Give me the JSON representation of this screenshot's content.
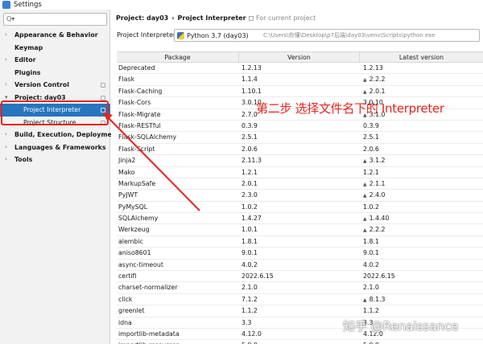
{
  "window": {
    "title": "Settings"
  },
  "search": {
    "placeholder": ""
  },
  "sidebar": {
    "items": [
      {
        "label": "Appearance & Behavior",
        "kind": "group",
        "expanded": false
      },
      {
        "label": "Keymap",
        "kind": "plain"
      },
      {
        "label": "Editor",
        "kind": "group",
        "expanded": false
      },
      {
        "label": "Plugins",
        "kind": "plain"
      },
      {
        "label": "Version Control",
        "kind": "group",
        "expanded": false
      },
      {
        "label": "Project: day03",
        "kind": "group",
        "expanded": true
      },
      {
        "label": "Project Interpreter",
        "kind": "sub",
        "selected": true
      },
      {
        "label": "Project Structure",
        "kind": "sub"
      },
      {
        "label": "Build, Execution, Deployment",
        "kind": "group",
        "expanded": false
      },
      {
        "label": "Languages & Frameworks",
        "kind": "group",
        "expanded": false
      },
      {
        "label": "Tools",
        "kind": "group",
        "expanded": false
      }
    ]
  },
  "header": {
    "crumb_project": "Project: day03",
    "crumb_sep": "›",
    "crumb_page": "Project Interpreter",
    "scope_note": "For current project"
  },
  "interpreter": {
    "label": "Project Interpreter:",
    "name": "Python 3.7 (day03)",
    "path": "C:\\Users\\你懂\\Desktop\\p7后端\\day03\\venv\\Scripts\\python.exe"
  },
  "table": {
    "columns": [
      "Package",
      "Version",
      "Latest version"
    ],
    "rows": [
      {
        "pkg": "Deprecated",
        "ver": "1.2.13",
        "latest": "1.2.13",
        "upgrade": false
      },
      {
        "pkg": "Flask",
        "ver": "1.1.4",
        "latest": "2.2.2",
        "upgrade": true
      },
      {
        "pkg": "Flask-Caching",
        "ver": "1.10.1",
        "latest": "2.0.1",
        "upgrade": true
      },
      {
        "pkg": "Flask-Cors",
        "ver": "3.0.10",
        "latest": "3.0.10",
        "upgrade": false
      },
      {
        "pkg": "Flask-Migrate",
        "ver": "2.7.0",
        "latest": "3.1.0",
        "upgrade": true
      },
      {
        "pkg": "Flask-RESTful",
        "ver": "0.3.9",
        "latest": "0.3.9",
        "upgrade": false
      },
      {
        "pkg": "Flask-SQLAlchemy",
        "ver": "2.5.1",
        "latest": "2.5.1",
        "upgrade": false
      },
      {
        "pkg": "Flask-Script",
        "ver": "2.0.6",
        "latest": "2.0.6",
        "upgrade": false
      },
      {
        "pkg": "Jinja2",
        "ver": "2.11.3",
        "latest": "3.1.2",
        "upgrade": true
      },
      {
        "pkg": "Mako",
        "ver": "1.2.1",
        "latest": "1.2.1",
        "upgrade": false
      },
      {
        "pkg": "MarkupSafe",
        "ver": "2.0.1",
        "latest": "2.1.1",
        "upgrade": true
      },
      {
        "pkg": "PyJWT",
        "ver": "2.3.0",
        "latest": "2.4.0",
        "upgrade": true
      },
      {
        "pkg": "PyMySQL",
        "ver": "1.0.2",
        "latest": "1.0.2",
        "upgrade": false
      },
      {
        "pkg": "SQLAlchemy",
        "ver": "1.4.27",
        "latest": "1.4.40",
        "upgrade": true
      },
      {
        "pkg": "Werkzeug",
        "ver": "1.0.1",
        "latest": "2.2.2",
        "upgrade": true
      },
      {
        "pkg": "alembic",
        "ver": "1.8.1",
        "latest": "1.8.1",
        "upgrade": false
      },
      {
        "pkg": "aniso8601",
        "ver": "9.0.1",
        "latest": "9.0.1",
        "upgrade": false
      },
      {
        "pkg": "async-timeout",
        "ver": "4.0.2",
        "latest": "4.0.2",
        "upgrade": false
      },
      {
        "pkg": "certifi",
        "ver": "2022.6.15",
        "latest": "2022.6.15",
        "upgrade": false
      },
      {
        "pkg": "charset-normalizer",
        "ver": "2.1.0",
        "latest": "2.1.0",
        "upgrade": false
      },
      {
        "pkg": "click",
        "ver": "7.1.2",
        "latest": "8.1.3",
        "upgrade": true
      },
      {
        "pkg": "greenlet",
        "ver": "1.1.2",
        "latest": "1.1.2",
        "upgrade": false
      },
      {
        "pkg": "idna",
        "ver": "3.3",
        "latest": "3.3",
        "upgrade": false
      },
      {
        "pkg": "importlib-metadata",
        "ver": "4.12.0",
        "latest": "4.12.0",
        "upgrade": false
      },
      {
        "pkg": "importlib-resources",
        "ver": "5.9.0",
        "latest": "5.9.0",
        "upgrade": false
      }
    ]
  },
  "annotation": {
    "text": "第二步 选择文件名下的 Interpreter",
    "color": "#e8231f"
  },
  "watermark": {
    "text": "知乎 @Renaissance"
  },
  "colors": {
    "selection": "#2675bf",
    "annotation": "#e8231f"
  }
}
